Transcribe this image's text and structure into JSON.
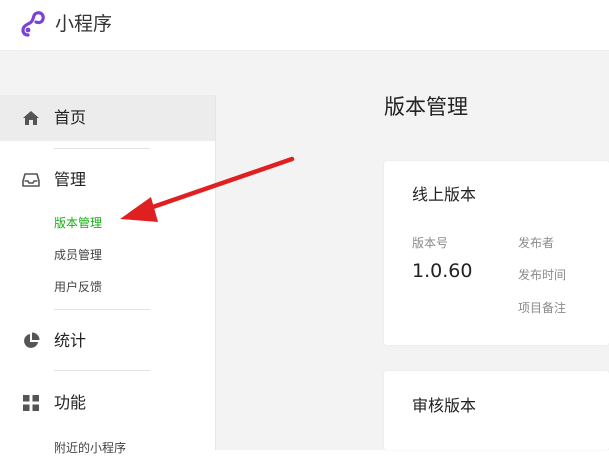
{
  "header": {
    "brand": "小程序",
    "logo_icon": "mini-program-logo-icon"
  },
  "sidebar": {
    "items": [
      {
        "label": "首页",
        "icon": "home-icon",
        "active": true
      },
      {
        "label": "管理",
        "icon": "inbox-icon",
        "sub_items": [
          "版本管理",
          "成员管理",
          "用户反馈"
        ],
        "active_sub": "版本管理"
      },
      {
        "label": "统计",
        "icon": "pie-chart-icon"
      },
      {
        "label": "功能",
        "icon": "grid-icon",
        "sub_items": [
          "附近的小程序"
        ]
      }
    ]
  },
  "main": {
    "title": "版本管理",
    "online_card": {
      "title": "线上版本",
      "version_label": "版本号",
      "version": "1.0.60",
      "publisher_label": "发布者",
      "publish_time_label": "发布时间",
      "remark_label": "项目备注"
    },
    "review_card": {
      "title": "审核版本"
    }
  },
  "colors": {
    "accent": "#1aad19",
    "arrow": "#e02020",
    "logo": "#7a43d8"
  }
}
